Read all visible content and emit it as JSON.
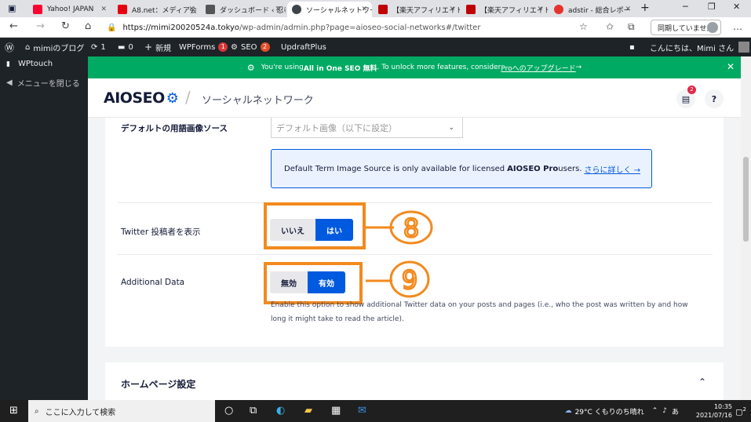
{
  "browser": {
    "tabs": [
      {
        "label": "Yahoo! JAPAN",
        "icon": "yahoo-icon",
        "color": "#ff0033"
      },
      {
        "label": "A8.net：メディア会",
        "icon": "a8-icon",
        "color": "#e60012"
      },
      {
        "label": "ダッシュボード ‹ 忍者",
        "icon": "ninja-icon",
        "color": "#555555"
      },
      {
        "label": "ソーシャルネットワーク",
        "icon": "wordpress-icon",
        "color": "#3c434a"
      },
      {
        "label": "【楽天アフィリエイト",
        "icon": "rakuten-icon",
        "color": "#bf0000"
      },
      {
        "label": "【楽天アフィリエイト",
        "icon": "rakuten-icon",
        "color": "#bf0000"
      },
      {
        "label": "adstir - 総合レポー",
        "icon": "adstir-icon",
        "color": "#e5322d"
      }
    ],
    "new_tab": "+",
    "url_host": "https://mimi20020524a.tokyo",
    "url_path": "/wp-admin/admin.php?page=aioseo-social-networks#/twitter",
    "sync_label": "同期していません"
  },
  "adminbar": {
    "site": "mimiのブログ",
    "updates": "1",
    "comments": "0",
    "new": "新規",
    "wpforms": "WPForms",
    "wpforms_count": "1",
    "seo": "SEO",
    "seo_count": "2",
    "updraft": "UpdraftPlus",
    "greeting": "こんにちは、Mimi さん"
  },
  "sidebar": {
    "item": "WPtouch",
    "collapse": "メニューを閉じる"
  },
  "notice": {
    "pre": "You're using ",
    "bold": "All in One SEO 無料",
    "mid": ". To unlock more features, consider ",
    "link": "Proへのアップグレード",
    "arrow": " →"
  },
  "header": {
    "logo": "AIOSEO",
    "title": "ソーシャルネットワーク",
    "notif_count": "2"
  },
  "settings": {
    "term_image_label": "デフォルトの用語画像ソース",
    "term_image_placeholder": "デフォルト画像（以下に設定）",
    "info_pre": "Default Term Image Source is only available for licensed ",
    "info_bold": "AIOSEO Pro",
    "info_mid": " users. ",
    "info_link": "さらに詳しく →",
    "twitter_author_label": "Twitter 投稿者を表示",
    "twitter_author_no": "いいえ",
    "twitter_author_yes": "はい",
    "additional_label": "Additional Data",
    "additional_off": "無効",
    "additional_on": "有効",
    "additional_desc": "Enable this option to show additional Twitter data on your posts and pages (i.e., who the post was written by and how long it might take to read the article)."
  },
  "annotations": {
    "eight": "8",
    "nine": "9",
    "color": "#f28a1e"
  },
  "homepage": {
    "title": "ホームページ設定"
  },
  "taskbar": {
    "search": "ここに入力して検索",
    "weather": "29°C くもりのち晴れ",
    "ime": "あ",
    "time": "10:35",
    "date": "2021/07/16",
    "notifications": "2"
  }
}
